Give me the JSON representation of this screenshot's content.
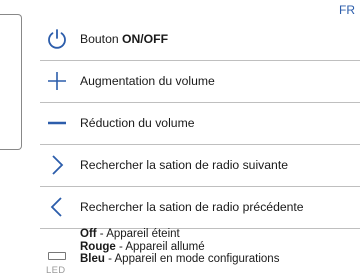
{
  "language": "FR",
  "colors": {
    "accent": "#2c5dab"
  },
  "rows": [
    {
      "icon": "power-icon",
      "prefix": "Bouton ",
      "bold": "ON/OFF",
      "suffix": ""
    },
    {
      "icon": "plus-icon",
      "prefix": "Augmentation du volume",
      "bold": "",
      "suffix": ""
    },
    {
      "icon": "minus-icon",
      "prefix": "Réduction du volume",
      "bold": "",
      "suffix": ""
    },
    {
      "icon": "chevron-right-icon",
      "prefix": "Rechercher la sation de radio suivante",
      "bold": "",
      "suffix": ""
    },
    {
      "icon": "chevron-left-icon",
      "prefix": "Rechercher la sation de radio précédente",
      "bold": "",
      "suffix": ""
    }
  ],
  "led": {
    "label": "LED",
    "states": [
      {
        "state": "Off",
        "description": " - Appareil éteint"
      },
      {
        "state": "Rouge",
        "description": " - Appareil allumé"
      },
      {
        "state": "Bleu",
        "description": " - Appareil en mode configurations"
      }
    ]
  }
}
